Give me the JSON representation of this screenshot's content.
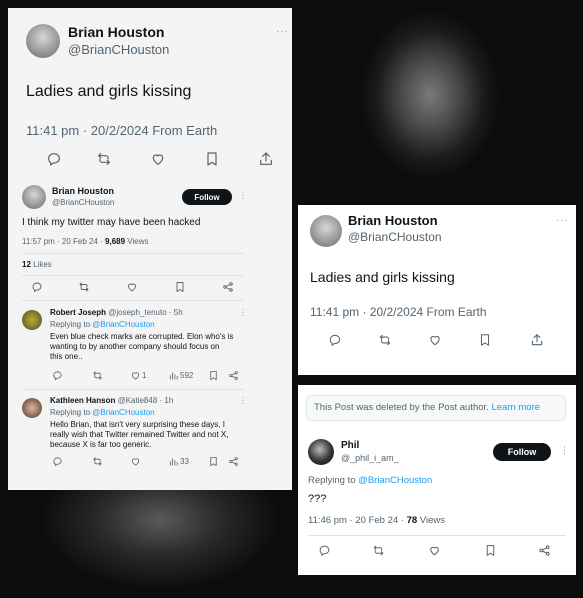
{
  "tweet1": {
    "name": "Brian Houston",
    "handle": "@BrianCHouston",
    "text": "Ladies and girls kissing",
    "time": "11:41 pm · 20/2/2024 From Earth"
  },
  "tweet2": {
    "name": "Brian Houston",
    "handle": "@BrianCHouston",
    "follow": "Follow",
    "text": "I think my twitter may have been hacked",
    "time": "11:57 pm · 20 Feb 24 · ",
    "views_count": "9,689",
    "views_label": " Views",
    "likes_count": "12",
    "likes_label": " Likes"
  },
  "replies": [
    {
      "name": "Robert Joseph",
      "meta": "@joseph_tenuto · 5h",
      "replying_prefix": "Replying to ",
      "replying_handle": "@BrianCHouston",
      "text_line1": "Even blue check marks are corrupted. Elon who's is",
      "text_line2": "wanting to by another company should focus on",
      "text_line3": "this one..",
      "likes": "1",
      "views": "592"
    },
    {
      "name": "Kathleen Hanson",
      "meta": "@Katie848 · 1h",
      "replying_prefix": "Replying to ",
      "replying_handle": "@BrianCHouston",
      "text_line1": "Hello Brian, that isn't very surprising these days, I",
      "text_line2": "really wish that Twitter remained Twitter and not X,",
      "text_line3": "because X is far too generic.",
      "views": "33"
    }
  ],
  "tweet3": {
    "name": "Brian Houston",
    "handle": "@BrianCHouston",
    "text": "Ladies and girls kissing",
    "time": "11:41 pm · 20/2/2024 From Earth"
  },
  "tweet4": {
    "deleted_notice": "This Post was deleted by the Post author.",
    "learn_more": "Learn more",
    "name": "Phil",
    "handle": "@_phil_i_am_",
    "follow": "Follow",
    "replying_prefix": "Replying to ",
    "replying_handle": "@BrianCHouston",
    "text": "???",
    "time": "11:46 pm · 20 Feb 24 · ",
    "views_count": "78",
    "views_label": " Views"
  },
  "icons": [
    "reply-icon",
    "retweet-icon",
    "like-icon",
    "bookmark-icon",
    "share-icon",
    "views-icon",
    "more-icon"
  ],
  "colors": {
    "link": "#1d9bf0",
    "text": "#0f1419",
    "secondary": "#536471",
    "background": "#0c0c0c"
  }
}
